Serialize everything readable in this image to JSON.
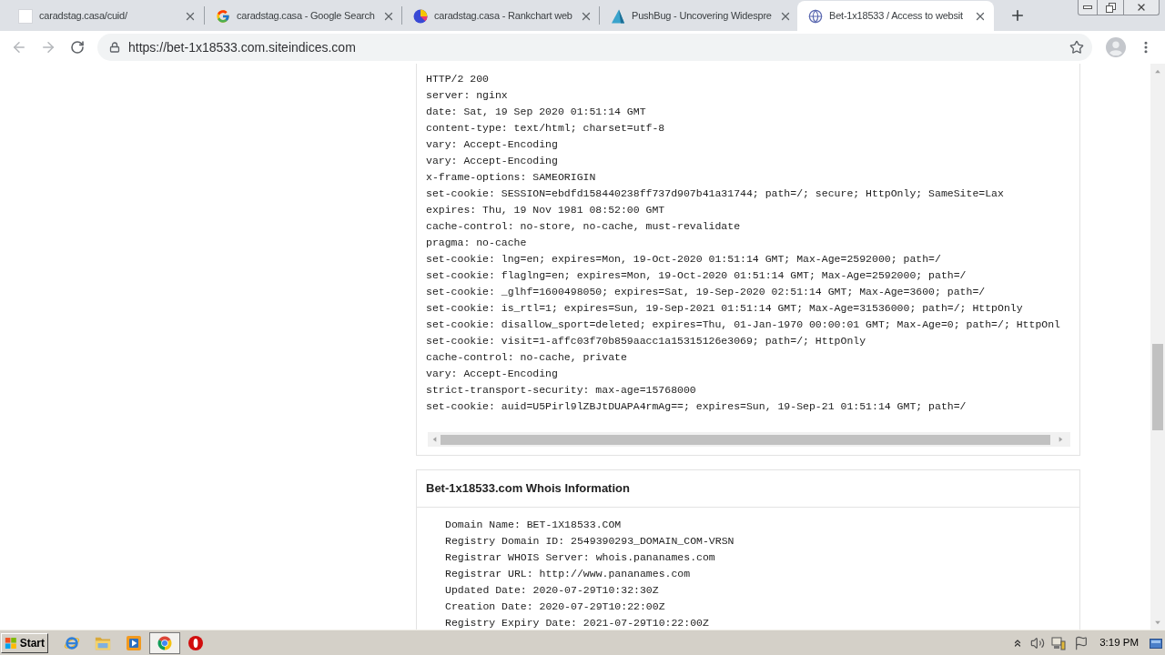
{
  "browser": {
    "tabs": [
      {
        "kind": "blank",
        "title": "caradstag.casa/cuid/",
        "selected": false
      },
      {
        "kind": "google",
        "title": "caradstag.casa - Google Search",
        "selected": false
      },
      {
        "kind": "pie",
        "title": "caradstag.casa - Rankchart web",
        "selected": false
      },
      {
        "kind": "pushbug",
        "title": "PushBug - Uncovering Widespre",
        "selected": false
      },
      {
        "kind": "globe",
        "title": "Bet-1x18533 / Access to websit",
        "selected": true
      }
    ],
    "address_bar": {
      "url": "https://bet-1x18533.com.siteindices.com"
    }
  },
  "headers_panel": {
    "lines": [
      "HTTP/2 200",
      "server: nginx",
      "date: Sat, 19 Sep 2020 01:51:14 GMT",
      "content-type: text/html; charset=utf-8",
      "vary: Accept-Encoding",
      "vary: Accept-Encoding",
      "x-frame-options: SAMEORIGIN",
      "set-cookie: SESSION=ebdfd158440238ff737d907b41a31744; path=/; secure; HttpOnly; SameSite=Lax",
      "expires: Thu, 19 Nov 1981 08:52:00 GMT",
      "cache-control: no-store, no-cache, must-revalidate",
      "pragma: no-cache",
      "set-cookie: lng=en; expires=Mon, 19-Oct-2020 01:51:14 GMT; Max-Age=2592000; path=/",
      "set-cookie: flaglng=en; expires=Mon, 19-Oct-2020 01:51:14 GMT; Max-Age=2592000; path=/",
      "set-cookie: _glhf=1600498050; expires=Sat, 19-Sep-2020 02:51:14 GMT; Max-Age=3600; path=/",
      "set-cookie: is_rtl=1; expires=Sun, 19-Sep-2021 01:51:14 GMT; Max-Age=31536000; path=/; HttpOnly",
      "set-cookie: disallow_sport=deleted; expires=Thu, 01-Jan-1970 00:00:01 GMT; Max-Age=0; path=/; HttpOnl",
      "set-cookie: visit=1-affc03f70b859aacc1a15315126e3069; path=/; HttpOnly",
      "cache-control: no-cache, private",
      "vary: Accept-Encoding",
      "strict-transport-security: max-age=15768000",
      "set-cookie: auid=U5Pirl9lZBJtDUAPA4rmAg==; expires=Sun, 19-Sep-21 01:51:14 GMT; path=/"
    ]
  },
  "whois_panel": {
    "title": "Bet-1x18533.com Whois Information",
    "lines": [
      "Domain Name: BET-1X18533.COM",
      "Registry Domain ID: 2549390293_DOMAIN_COM-VRSN",
      "Registrar WHOIS Server: whois.pananames.com",
      "Registrar URL: http://www.pananames.com",
      "Updated Date: 2020-07-29T10:32:30Z",
      "Creation Date: 2020-07-29T10:22:00Z",
      "Registry Expiry Date: 2021-07-29T10:22:00Z"
    ]
  },
  "taskbar": {
    "start_label": "Start",
    "apps": [
      {
        "kind": "ie",
        "selected": false
      },
      {
        "kind": "folder",
        "selected": false
      },
      {
        "kind": "media",
        "selected": false
      },
      {
        "kind": "chrome",
        "selected": true
      },
      {
        "kind": "stop",
        "selected": false
      }
    ],
    "clock": "3:19 PM"
  }
}
